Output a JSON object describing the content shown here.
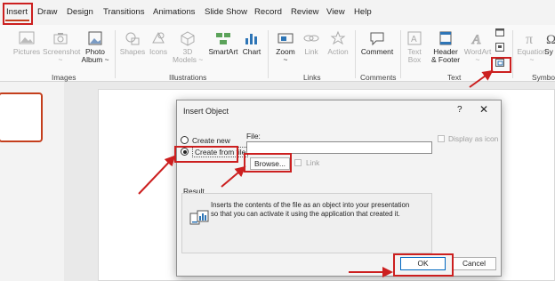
{
  "tabs": {
    "insert": "Insert",
    "draw": "Draw",
    "design": "Design",
    "transitions": "Transitions",
    "animations": "Animations",
    "slideshow": "Slide Show",
    "record": "Record",
    "review": "Review",
    "view": "View",
    "help": "Help"
  },
  "ribbon": {
    "pictures": "Pictures",
    "screenshot1": "Screenshot",
    "screenshot2": "~",
    "photo1": "Photo",
    "photo2": "Album ~",
    "shapes": "Shapes",
    "icons": "Icons",
    "models1": "3D",
    "models2": "Models ~",
    "smartart": "SmartArt",
    "chart": "Chart",
    "zoom1": "Zoom",
    "zoom2": "~",
    "link": "Link",
    "action": "Action",
    "comment": "Comment",
    "textbox1": "Text",
    "textbox2": "Box",
    "header1": "Header",
    "header2": "& Footer",
    "wordart1": "WordArt",
    "wordart2": "~",
    "equation1": "Equation",
    "equation2": "~",
    "symbols": "Sy",
    "groups": {
      "images": "Images",
      "illustrations": "Illustrations",
      "links": "Links",
      "comments": "Comments",
      "text": "Text",
      "symbols": "Symbo"
    }
  },
  "dialog": {
    "title": "Insert Object",
    "help": "?",
    "close": "✕",
    "create_new": "Create new",
    "create_from_file": "Create from file",
    "file_label": "File:",
    "file_value": "",
    "browse": "Browse...",
    "link": "Link",
    "display_as_icon": "Display as icon",
    "result_title": "Result",
    "result_text": "Inserts the contents of the file as an object into your presentation so that you can activate it using the application that created it.",
    "ok": "OK",
    "cancel": "Cancel"
  },
  "colors": {
    "accent": "#c43e1c",
    "highlight": "#cc1f1f",
    "ok_border": "#0067c0"
  }
}
